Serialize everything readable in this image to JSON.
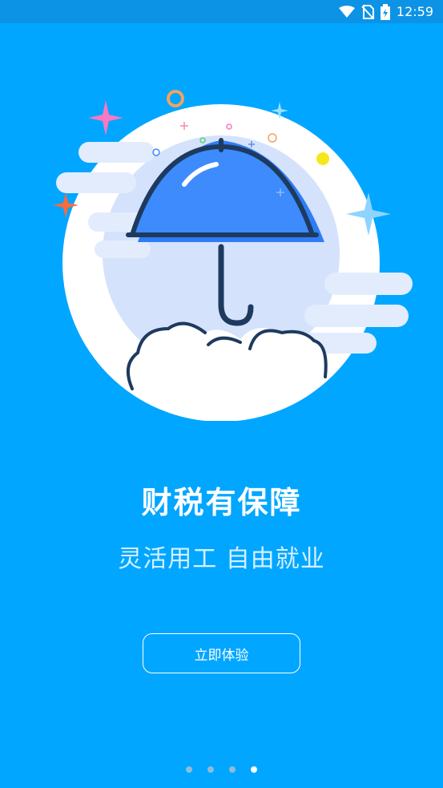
{
  "status_bar": {
    "time": "12:59",
    "icons": [
      "wifi-icon",
      "no-sim-icon",
      "battery-charging-icon"
    ]
  },
  "onboarding": {
    "title": "财税有保障",
    "subtitle": "灵活用工 自由就业",
    "cta_label": "立即体验",
    "page_indicator": {
      "total": 4,
      "current": 4
    }
  },
  "colors": {
    "background": "#00a6ff",
    "status_bar": "#0d93e6",
    "umbrella_canopy": "#3d8bfd",
    "outline": "#1e3a5f"
  }
}
